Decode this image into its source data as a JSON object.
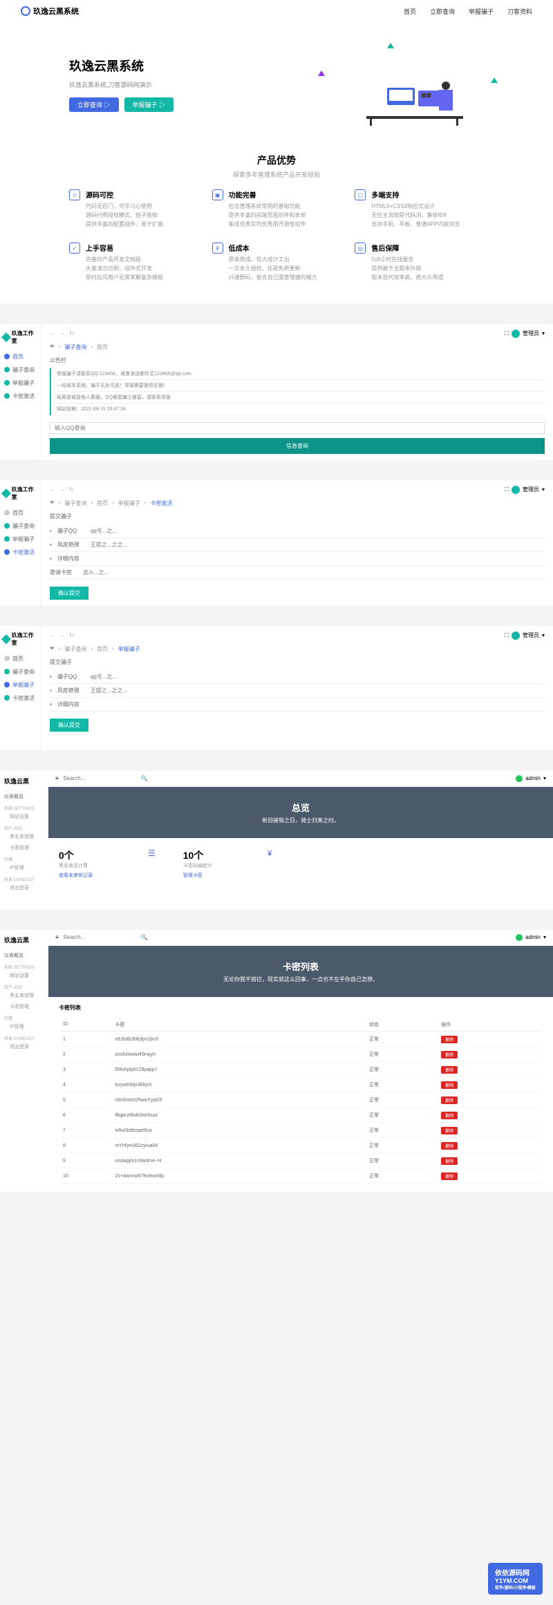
{
  "nav": {
    "logo": "玖逸云黑系统",
    "links": [
      "首页",
      "立即查询",
      "举报骗子",
      "刀客资料"
    ]
  },
  "hero": {
    "title": "玖逸云黑系统",
    "subtitle": "玖逸云黑系统,刀客源码网演示",
    "btn1": "立即查询 ▷",
    "btn2": "举报骗子 ▷"
  },
  "features": {
    "title": "产品优势",
    "subtitle": "探索多年管理系统产品开发经验",
    "items": [
      {
        "title": "源码可控",
        "desc": "代码无后门，可学习心使用\n源码付费授权模式，搭子维权\n提供丰富的配置插件，易于扩展"
      },
      {
        "title": "功能完善",
        "desc": "包含管理系统常用的基础功能\n提供丰富的前端页面组件和表单\n集成优秀实列优秀用开源性组件"
      },
      {
        "title": "多端支持",
        "desc": "HTML5+CSS3响应式设计\n无任主流现提代码浏，兼容IE8\n支持手机、平板、普通APP内嵌浏览"
      },
      {
        "title": "上手容易",
        "desc": "完备的产品开发文档授\n大量演示功例，组件式开发\n现时应问用户无需掌解复杂模板"
      },
      {
        "title": "低成本",
        "desc": "原来原成，低大成计工出\n一次永久授权，任是免费更新\n兴通野码，省去自己面管理捷的精力"
      },
      {
        "title": "售后保障",
        "desc": "5x8小时在线服务\n提供基于主题本升级\n版本迭代效率高，费大众用道"
      }
    ]
  },
  "panel1": {
    "logo": "玖逸工作室",
    "sidebar": [
      "首页",
      "骗子查询",
      "举报骗子",
      "卡密激活"
    ],
    "user": "管理员",
    "breadcrumb": [
      "❤",
      "骗子查询",
      "首页"
    ],
    "noticeTitle": "公告栏",
    "notices": [
      "举报骗子请联系QQ:123456，或者发送邮件至123456@qq.com",
      "一经被本系统、骗子无处可逃！举报需要提供证据！",
      "结果是被监他人黄骗，QQ被监骗士被监，请联系举报",
      "网站投稿：2022-09-15 20:47:34"
    ],
    "inputPlaceholder": "输入QQ查询",
    "submitBtn": "信息查询"
  },
  "panel2": {
    "logo": "玖逸工作室",
    "sidebar": [
      "首页",
      "骗子查询",
      "举报骗子",
      "卡密激活"
    ],
    "sidebarActive": 3,
    "user": "管理员",
    "breadcrumb": [
      "❤",
      "骗子查询",
      "首页",
      "举报骗子",
      "卡密激活"
    ],
    "formTitle": "提交骗子",
    "fields": [
      {
        "label": "骗子QQ",
        "placeholder": "qq号...之..."
      },
      {
        "label": "凤皮艳理",
        "placeholder": "王提之...之之..."
      },
      {
        "label": "详细内容",
        "placeholder": ""
      }
    ],
    "cardLabel": "邀请卡密",
    "cardPlaceholder": "选入...之...",
    "submitBtn": "确认提交"
  },
  "panel3": {
    "logo": "玖逸工作室",
    "sidebar": [
      "首页",
      "骗子查询",
      "举报骗子",
      "卡密激活"
    ],
    "sidebarActive": 2,
    "user": "管理员",
    "breadcrumb": [
      "❤",
      "骗子查询",
      "首页",
      "举报骗子"
    ],
    "formTitle": "提交骗子",
    "fields": [
      {
        "label": "骗子QQ",
        "placeholder": "qq号...之..."
      },
      {
        "label": "凤皮艳理",
        "placeholder": "王提之...之之..."
      },
      {
        "label": "详细内容",
        "placeholder": ""
      }
    ],
    "submitBtn": "确认提交"
  },
  "admin1": {
    "title": "玖逸云黑",
    "sidebar": {
      "items": [
        "仪表概览"
      ],
      "label1": "系统 SETTINGS",
      "items2": [
        "网站设置"
      ],
      "label2": "用户 ADD",
      "items3": [
        "黑名单管理",
        "卡密管理"
      ],
      "label3": "代理",
      "items4": [
        "IP管理"
      ],
      "label4": "收录 CONDUCT",
      "items5": [
        "退出登录"
      ]
    },
    "searchPlaceholder": "Search...",
    "user": "admin",
    "banner": {
      "title": "总览",
      "subtitle": "新旧摧毁之日，骑士归来之时。"
    },
    "stats": [
      {
        "num": "0个",
        "label": "黑名单总计算",
        "link": "查看未审核记录"
      },
      {
        "num": "10个",
        "label": "卡密码编统计",
        "link": "管理卡密"
      }
    ]
  },
  "admin2": {
    "title": "玖逸云黑",
    "searchPlaceholder": "Search...",
    "user": "admin",
    "banner": {
      "title": "卡密列表",
      "subtitle": "无论你我不搭拉，现实就这么回事，一点也不左乎你自己怎想。"
    },
    "tableTitle": "卡密列表",
    "headers": [
      "ID",
      "卡密",
      "状态",
      "操作"
    ],
    "rows": [
      {
        "id": "1",
        "key": "e6JbdbJ68j3pv1bv3",
        "status": "正常"
      },
      {
        "id": "2",
        "key": "zosfu0wow45nxjyh",
        "status": "正常"
      },
      {
        "id": "3",
        "key": "f58uhjdy6129yajqU",
        "status": "正常"
      },
      {
        "id": "4",
        "key": "bzyw93itjx36hjx5",
        "status": "正常"
      },
      {
        "id": "5",
        "key": "c8mhsts02hwoYypG5",
        "status": "正常"
      },
      {
        "id": "6",
        "key": "f8qpnzt9ukt3xk5caz",
        "status": "正常"
      },
      {
        "id": "7",
        "key": "w8ut3otttzppt5ca",
        "status": "正常"
      },
      {
        "id": "8",
        "key": "mYhfym362zyIua04",
        "status": "正常"
      },
      {
        "id": "9",
        "key": "onowpjm1n9a3m4~nt",
        "status": "正常"
      },
      {
        "id": "10",
        "key": "2s+4wnnuN7ho9sw5lp",
        "status": "正常"
      }
    ],
    "delLabel": "删除"
  },
  "watermark": {
    "main": "依依源码网",
    "sub": "软件/源码/小程序/模板",
    "url": "Y1YM.COM"
  }
}
